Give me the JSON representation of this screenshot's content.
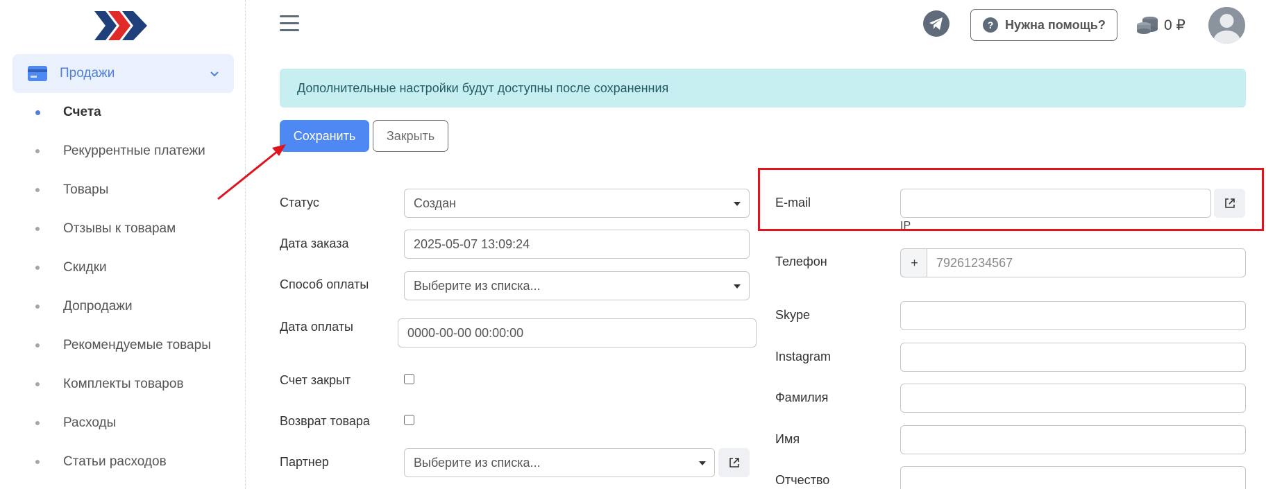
{
  "sidebar": {
    "section_label": "Продажи",
    "items": [
      {
        "label": "Счета",
        "active": true
      },
      {
        "label": "Рекуррентные платежи"
      },
      {
        "label": "Товары"
      },
      {
        "label": "Отзывы к товарам"
      },
      {
        "label": "Скидки"
      },
      {
        "label": "Допродажи"
      },
      {
        "label": "Рекомендуемые товары"
      },
      {
        "label": "Комплекты товаров"
      },
      {
        "label": "Расходы"
      },
      {
        "label": "Статьи расходов"
      }
    ]
  },
  "header": {
    "help_label": "Нужна помощь?",
    "balance": "0 ₽",
    "icons": [
      "menu-icon",
      "telegram-icon",
      "help-icon",
      "coins-icon",
      "user-avatar-icon"
    ]
  },
  "alert": "Дополнительные настройки будут доступны после сохраненния",
  "actions": {
    "save_label": "Сохранить",
    "close_label": "Закрыть"
  },
  "form_left": {
    "status": {
      "label": "Статус",
      "value": "Создан"
    },
    "order_date": {
      "label": "Дата заказа",
      "value": "2025-05-07 13:09:24"
    },
    "payment_method": {
      "label": "Способ оплаты",
      "value": "Выберите из списка..."
    },
    "payment_date": {
      "label": "Дата оплаты",
      "value": "0000-00-00 00:00:00"
    },
    "invoice_closed": {
      "label": "Счет закрыт",
      "checked": false
    },
    "product_return": {
      "label": "Возврат товара",
      "checked": false
    },
    "partner": {
      "label": "Партнер",
      "value": "Выберите из списка..."
    }
  },
  "form_right": {
    "email": {
      "label": "E-mail",
      "value": ""
    },
    "ip_label": "IP",
    "phone": {
      "label": "Телефон",
      "prefix": "+",
      "placeholder": "79261234567"
    },
    "skype": {
      "label": "Skype",
      "value": ""
    },
    "instagram": {
      "label": "Instagram",
      "value": ""
    },
    "last_name": {
      "label": "Фамилия",
      "value": ""
    },
    "first_name": {
      "label": "Имя",
      "value": ""
    },
    "middle_name": {
      "label": "Отчество",
      "value": ""
    }
  },
  "colors": {
    "primary": "#4e88f2",
    "alert_bg": "#c7eef1",
    "highlight": "#e0141e",
    "nav_active_bg": "#ebf1fc"
  }
}
